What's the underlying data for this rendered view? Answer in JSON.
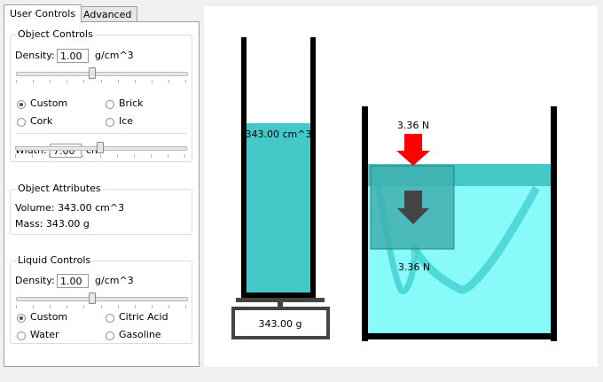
{
  "tabs": [
    {
      "label": "User Controls",
      "active": true
    },
    {
      "label": "Advanced",
      "active": false
    }
  ],
  "object_controls": {
    "title": "Object Controls",
    "density_label": "Density:",
    "density_value": "1.00",
    "density_unit": "g/cm^3",
    "density_slider_fraction": 0.45,
    "materials": [
      {
        "label": "Custom",
        "checked": true
      },
      {
        "label": "Brick",
        "checked": false
      },
      {
        "label": "Cork",
        "checked": false
      },
      {
        "label": "Ice",
        "checked": false
      }
    ],
    "width_label": "Width:",
    "width_value": "7.00",
    "width_unit": "cm",
    "width_slider_fraction": 0.5
  },
  "object_attributes": {
    "title": "Object Attributes",
    "volume_text": "Volume: 343.00 cm^3",
    "mass_text": "Mass: 343.00 g"
  },
  "liquid_controls": {
    "title": "Liquid Controls",
    "density_label": "Density:",
    "density_value": "1.00",
    "density_unit": "g/cm^3",
    "density_slider_fraction": 0.45,
    "liquids": [
      {
        "label": "Custom",
        "checked": true
      },
      {
        "label": "Citric Acid",
        "checked": false
      },
      {
        "label": "Water",
        "checked": false
      },
      {
        "label": "Gasoline",
        "checked": false
      }
    ]
  },
  "simulation": {
    "cylinder_volume_label": "343.00 cm^3",
    "scale_reading": "343.00 g",
    "force_top_label": "3.36 N",
    "force_bottom_label": "3.36 N",
    "colors": {
      "cylinder_liquid": "#44c8c8",
      "tank_liquid": "#88fafa",
      "surface_band": "#44c8c8",
      "object": "#4cb4b4",
      "force_arrow_down_top": "#ff0000",
      "gravity_arrow": "#444444",
      "buoyancy_arrow": "#66e0e0",
      "walls": "#000000"
    }
  }
}
